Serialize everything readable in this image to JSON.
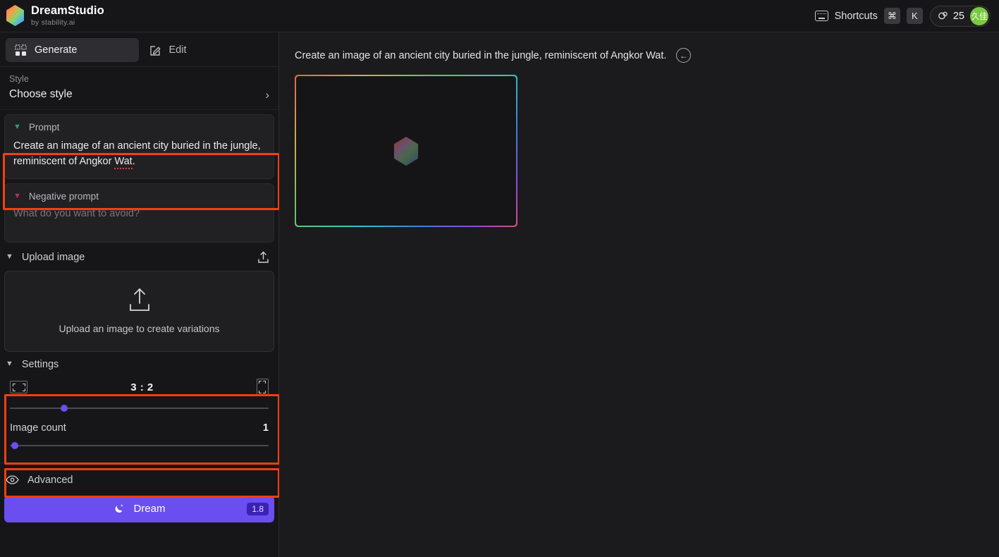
{
  "brand": {
    "name": "DreamStudio",
    "subtitle": "by stability.ai",
    "logo_icon": "hexagon-gradient-logo"
  },
  "topbar": {
    "keyboard_icon": "keyboard-icon",
    "shortcuts_label": "Shortcuts",
    "key_command": "⌘",
    "key_letter": "K",
    "credits_icon": "credits-coin-icon",
    "credits_value": "25",
    "avatar_initials": "久佳",
    "avatar_color": "#7ac943"
  },
  "sidebar": {
    "tabs": [
      {
        "label": "Generate",
        "icon": "grid-squares-icon",
        "active": true
      },
      {
        "label": "Edit",
        "icon": "pencil-square-icon",
        "active": false
      }
    ],
    "style": {
      "label": "Style",
      "value": "Choose style",
      "chevron_icon": "chevron-right-icon"
    },
    "prompt": {
      "title": "Prompt",
      "chevron_icon": "chevron-down-icon",
      "chevron_color": "#2f9e6b",
      "text_before": "Create an image of an ancient city buried in the jungle, reminiscent of Angkor ",
      "text_misspelled": "Wat",
      "text_after": "."
    },
    "negative_prompt": {
      "title": "Negative prompt",
      "chevron_icon": "chevron-down-icon",
      "chevron_color": "#b5344f",
      "placeholder": "What do you want to avoid?",
      "value": ""
    },
    "upload": {
      "title": "Upload image",
      "chevron_icon": "chevron-down-icon",
      "header_icon": "upload-icon",
      "dropzone_icon": "upload-icon",
      "dropzone_label": "Upload an image to create variations"
    },
    "settings": {
      "title": "Settings",
      "chevron_icon": "chevron-down-icon",
      "aspect_ratio": {
        "landscape_icon": "crop-landscape-icon",
        "portrait_icon": "crop-portrait-icon",
        "value": "3 : 2",
        "slider_percent": 21
      }
    },
    "image_count": {
      "label": "Image count",
      "value": "1",
      "slider_percent": 2
    },
    "advanced": {
      "label": "Advanced",
      "icon": "eye-icon"
    },
    "dream": {
      "icon": "moon-sparkle-icon",
      "label": "Dream",
      "cost": "1.8",
      "accent_color": "#6b4ef0"
    }
  },
  "main": {
    "prompt_heading": "Create an image of an ancient city buried in the jungle, reminiscent of Angkor Wat.",
    "back_icon": "circle-arrow-left-icon",
    "generation_card": {
      "state_icon": "hexagon-gradient-loader",
      "border_style": "rainbow-gradient"
    }
  },
  "annotations": {
    "highlight_color": "#f43f10",
    "boxes": [
      "prompt-section",
      "settings-section",
      "image-count-section"
    ]
  }
}
